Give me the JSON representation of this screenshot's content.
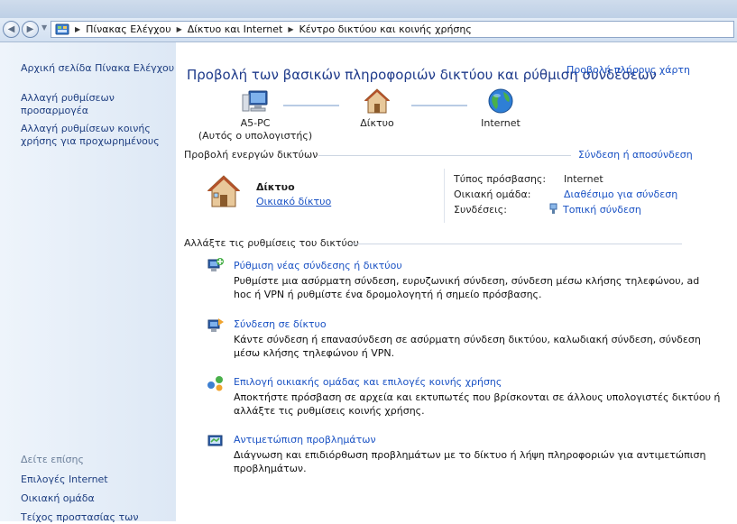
{
  "window": {
    "title": ""
  },
  "address": {
    "crumbs": [
      "Πίνακας Ελέγχου",
      "Δίκτυο και Internet",
      "Κέντρο δικτύου και κοινής χρήσης"
    ]
  },
  "sidebar": {
    "items": [
      {
        "label": "Αρχική σελίδα Πίνακα Ελέγχου"
      },
      {
        "label_line1": "Αλλαγή ρυθμίσεων",
        "label_line2": "προσαρμογέα"
      },
      {
        "label_line1": "Αλλαγή ρυθμίσεων κοινής",
        "label_line2": "χρήσης για προχωρημένους"
      }
    ],
    "see_also": "Δείτε επίσης",
    "see_also_items": [
      "Επιλογές Internet",
      "Οικιακή ομάδα",
      "Τείχος προστασίας των"
    ]
  },
  "main": {
    "title": "Προβολή των βασικών πληροφοριών δικτύου και ρύθμιση συνδέσεων",
    "view_full_map": "Προβολή πλήρους χάρτη",
    "map": {
      "computer": "A5-PC",
      "computer_sub": "(Αυτός ο υπολογιστής)",
      "network": "Δίκτυο",
      "internet": "Internet"
    },
    "active_networks": {
      "heading": "Προβολή ενεργών δικτύων",
      "connect_disconnect": "Σύνδεση ή αποσύνδεση",
      "network_name": "Δίκτυο",
      "network_type": "Οικιακό δίκτυο",
      "access_type_label": "Τύπος πρόσβασης:",
      "access_type_value": "Internet",
      "homegroup_label": "Οικιακή ομάδα:",
      "homegroup_value": "Διαθέσιμο για σύνδεση",
      "connections_label": "Συνδέσεις:",
      "connections_value": "Τοπική σύνδεση"
    },
    "change_settings": {
      "heading": "Αλλάξτε τις ρυθμίσεις του δικτύου",
      "tasks": [
        {
          "title": "Ρύθμιση νέας σύνδεσης ή δικτύου",
          "desc1": "Ρυθμίστε μια ασύρματη σύνδεση, ευρυζωνική σύνδεση, σύνδεση μέσω κλήσης τηλεφώνου, ad",
          "desc2": "hoc ή VPN ή ρυθμίστε ένα δρομολογητή ή σημείο πρόσβασης."
        },
        {
          "title": "Σύνδεση σε δίκτυο",
          "desc1": "Κάντε σύνδεση ή επανασύνδεση σε ασύρματη σύνδεση δικτύου, καλωδιακή σύνδεση, σύνδεση",
          "desc2": "μέσω κλήσης τηλεφώνου ή VPN."
        },
        {
          "title": "Επιλογή οικιακής ομάδας και επιλογές κοινής χρήσης",
          "desc1": "Αποκτήστε πρόσβαση σε αρχεία και εκτυπωτές που βρίσκονται σε άλλους υπολογιστές δικτύου ή",
          "desc2": "αλλάξτε τις ρυθμίσεις κοινής χρήσης."
        },
        {
          "title": "Αντιμετώπιση προβλημάτων",
          "desc1": "Διάγνωση και επιδιόρθωση προβλημάτων με το δίκτυο ή λήψη πληροφοριών για αντιμετώπιση",
          "desc2": "προβλημάτων."
        }
      ]
    }
  },
  "colors": {
    "link": "#1a52c4",
    "title": "#1e3a8a",
    "sidebar_link": "#1e3e80",
    "sidebar_bg": "#e4edf8"
  },
  "icons": [
    "back-arrow-icon",
    "forward-arrow-icon",
    "control-panel-icon",
    "computer-icon",
    "house-icon",
    "globe-icon",
    "ethernet-icon",
    "new-connection-icon",
    "connect-network-icon",
    "homegroup-icon",
    "troubleshoot-icon"
  ]
}
